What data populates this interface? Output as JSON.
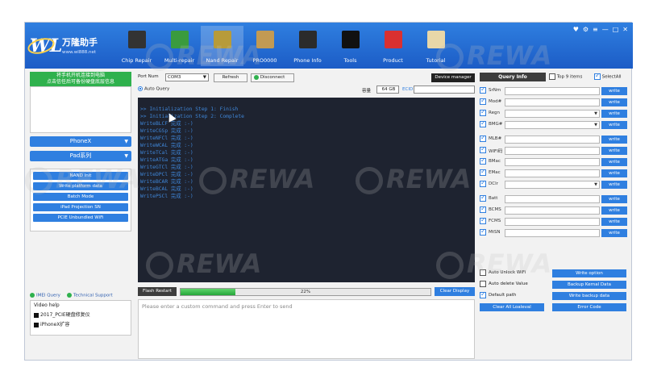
{
  "header": {
    "logo_mark": "WL",
    "logo_text": "万隆助手",
    "logo_url": "www.wl888.net",
    "nav": [
      {
        "label": "Chip Repair",
        "icon": "chip-icon",
        "color": "#333333"
      },
      {
        "label": "Multi-repair",
        "icon": "battery-icon",
        "color": "#3a9b3e"
      },
      {
        "label": "Nand Repair",
        "icon": "nand-icon",
        "color": "#b79b3a",
        "active": true
      },
      {
        "label": "PRO0000",
        "icon": "programmer-icon",
        "color": "#c29a53"
      },
      {
        "label": "Phone Info",
        "icon": "phone-icon",
        "color": "#2b2b2b"
      },
      {
        "label": "Tools",
        "icon": "oscilloscope-icon",
        "color": "#111111"
      },
      {
        "label": "Product",
        "icon": "cart-icon",
        "color": "#d93030"
      },
      {
        "label": "Tutorial",
        "icon": "tutorial-icon",
        "color": "#e8d7a8"
      }
    ],
    "window_buttons": [
      "♥",
      "⚙",
      "≡",
      "—",
      "□",
      "✕"
    ]
  },
  "left": {
    "banner_line1": "将手机开机连接到电脑",
    "banner_line2": "点击信任后可备份硬盘底层信息",
    "model_select": "PhoneX",
    "series_select": "Pad系列",
    "buttons": [
      "NAND Init",
      "Write platform data",
      "Batch Mode",
      "iPad Projection SN",
      "PCIE Unbundled WiFi"
    ],
    "imei_query": "IMEI Query",
    "tech_support": "Technical Support",
    "video_help_title": "Video help",
    "videos": [
      "2017_PCIE硬盘修复仪",
      "iPhoneX扩容"
    ]
  },
  "topbar": {
    "port_label": "Port Num",
    "port_value": "COM3",
    "refresh": "Refresh",
    "disconnect": "Disconnect",
    "device_manager": "Device manager",
    "auto_query": "Auto Query",
    "capacity_label": "容量",
    "capacity_value": "64 GB",
    "ecid_label": "ECID"
  },
  "console": {
    "lines": [
      ">> Initialization Step 1: Finish",
      ">> Initialization Step 2: Complete",
      "WriteBLCF 完成 :-)",
      "WriteCGSp 完成 :-)",
      "WriteNFCl 完成 :-)",
      "WriteWCAL 完成 :-)",
      "WriteTCal 完成 :-)",
      "WriteATGa 完成 :-)",
      "WriteGTCl 完成 :-)",
      "WriteDPCl 完成 :-)",
      "WriteBCAR 完成 :-)",
      "WriteBCAL 完成 :-)",
      "WritePSCl 完成 :-)"
    ]
  },
  "progress": {
    "flash_restart": "Flash Restart",
    "percent_label": "22%",
    "value": 0.22,
    "clear_display": "Clear Display"
  },
  "command": {
    "placeholder": "Please enter a custom command and press Enter to send"
  },
  "right": {
    "query_info": "Query Info",
    "top9": "Top 9 items",
    "select_all": "SelectAll",
    "fields": [
      {
        "label": "SrNm",
        "dropdown": false
      },
      {
        "label": "Mod#",
        "dropdown": false
      },
      {
        "label": "Regn",
        "dropdown": true
      },
      {
        "label": "BMG#",
        "dropdown": true
      },
      {
        "label": "MLB#",
        "dropdown": false
      },
      {
        "label": "WIFI码",
        "dropdown": false
      },
      {
        "label": "BMac",
        "dropdown": false
      },
      {
        "label": "EMac",
        "dropdown": false
      },
      {
        "label": "DClr",
        "dropdown": true
      },
      {
        "label": "Batt",
        "dropdown": false
      },
      {
        "label": "BCMS",
        "dropdown": false
      },
      {
        "label": "FCMS",
        "dropdown": false
      },
      {
        "label": "MtSN",
        "dropdown": false
      }
    ],
    "write_label": "write",
    "options": [
      {
        "label": "Auto Unlock WiFi",
        "checked": false,
        "button": "Write option"
      },
      {
        "label": "Auto delete Value",
        "checked": false,
        "button": "Backup Kernal Data"
      },
      {
        "label": "Default path",
        "checked": true,
        "button": "Write backup data"
      }
    ],
    "clear_all": "Clear All Loaleval",
    "error_code": "Error Code"
  }
}
